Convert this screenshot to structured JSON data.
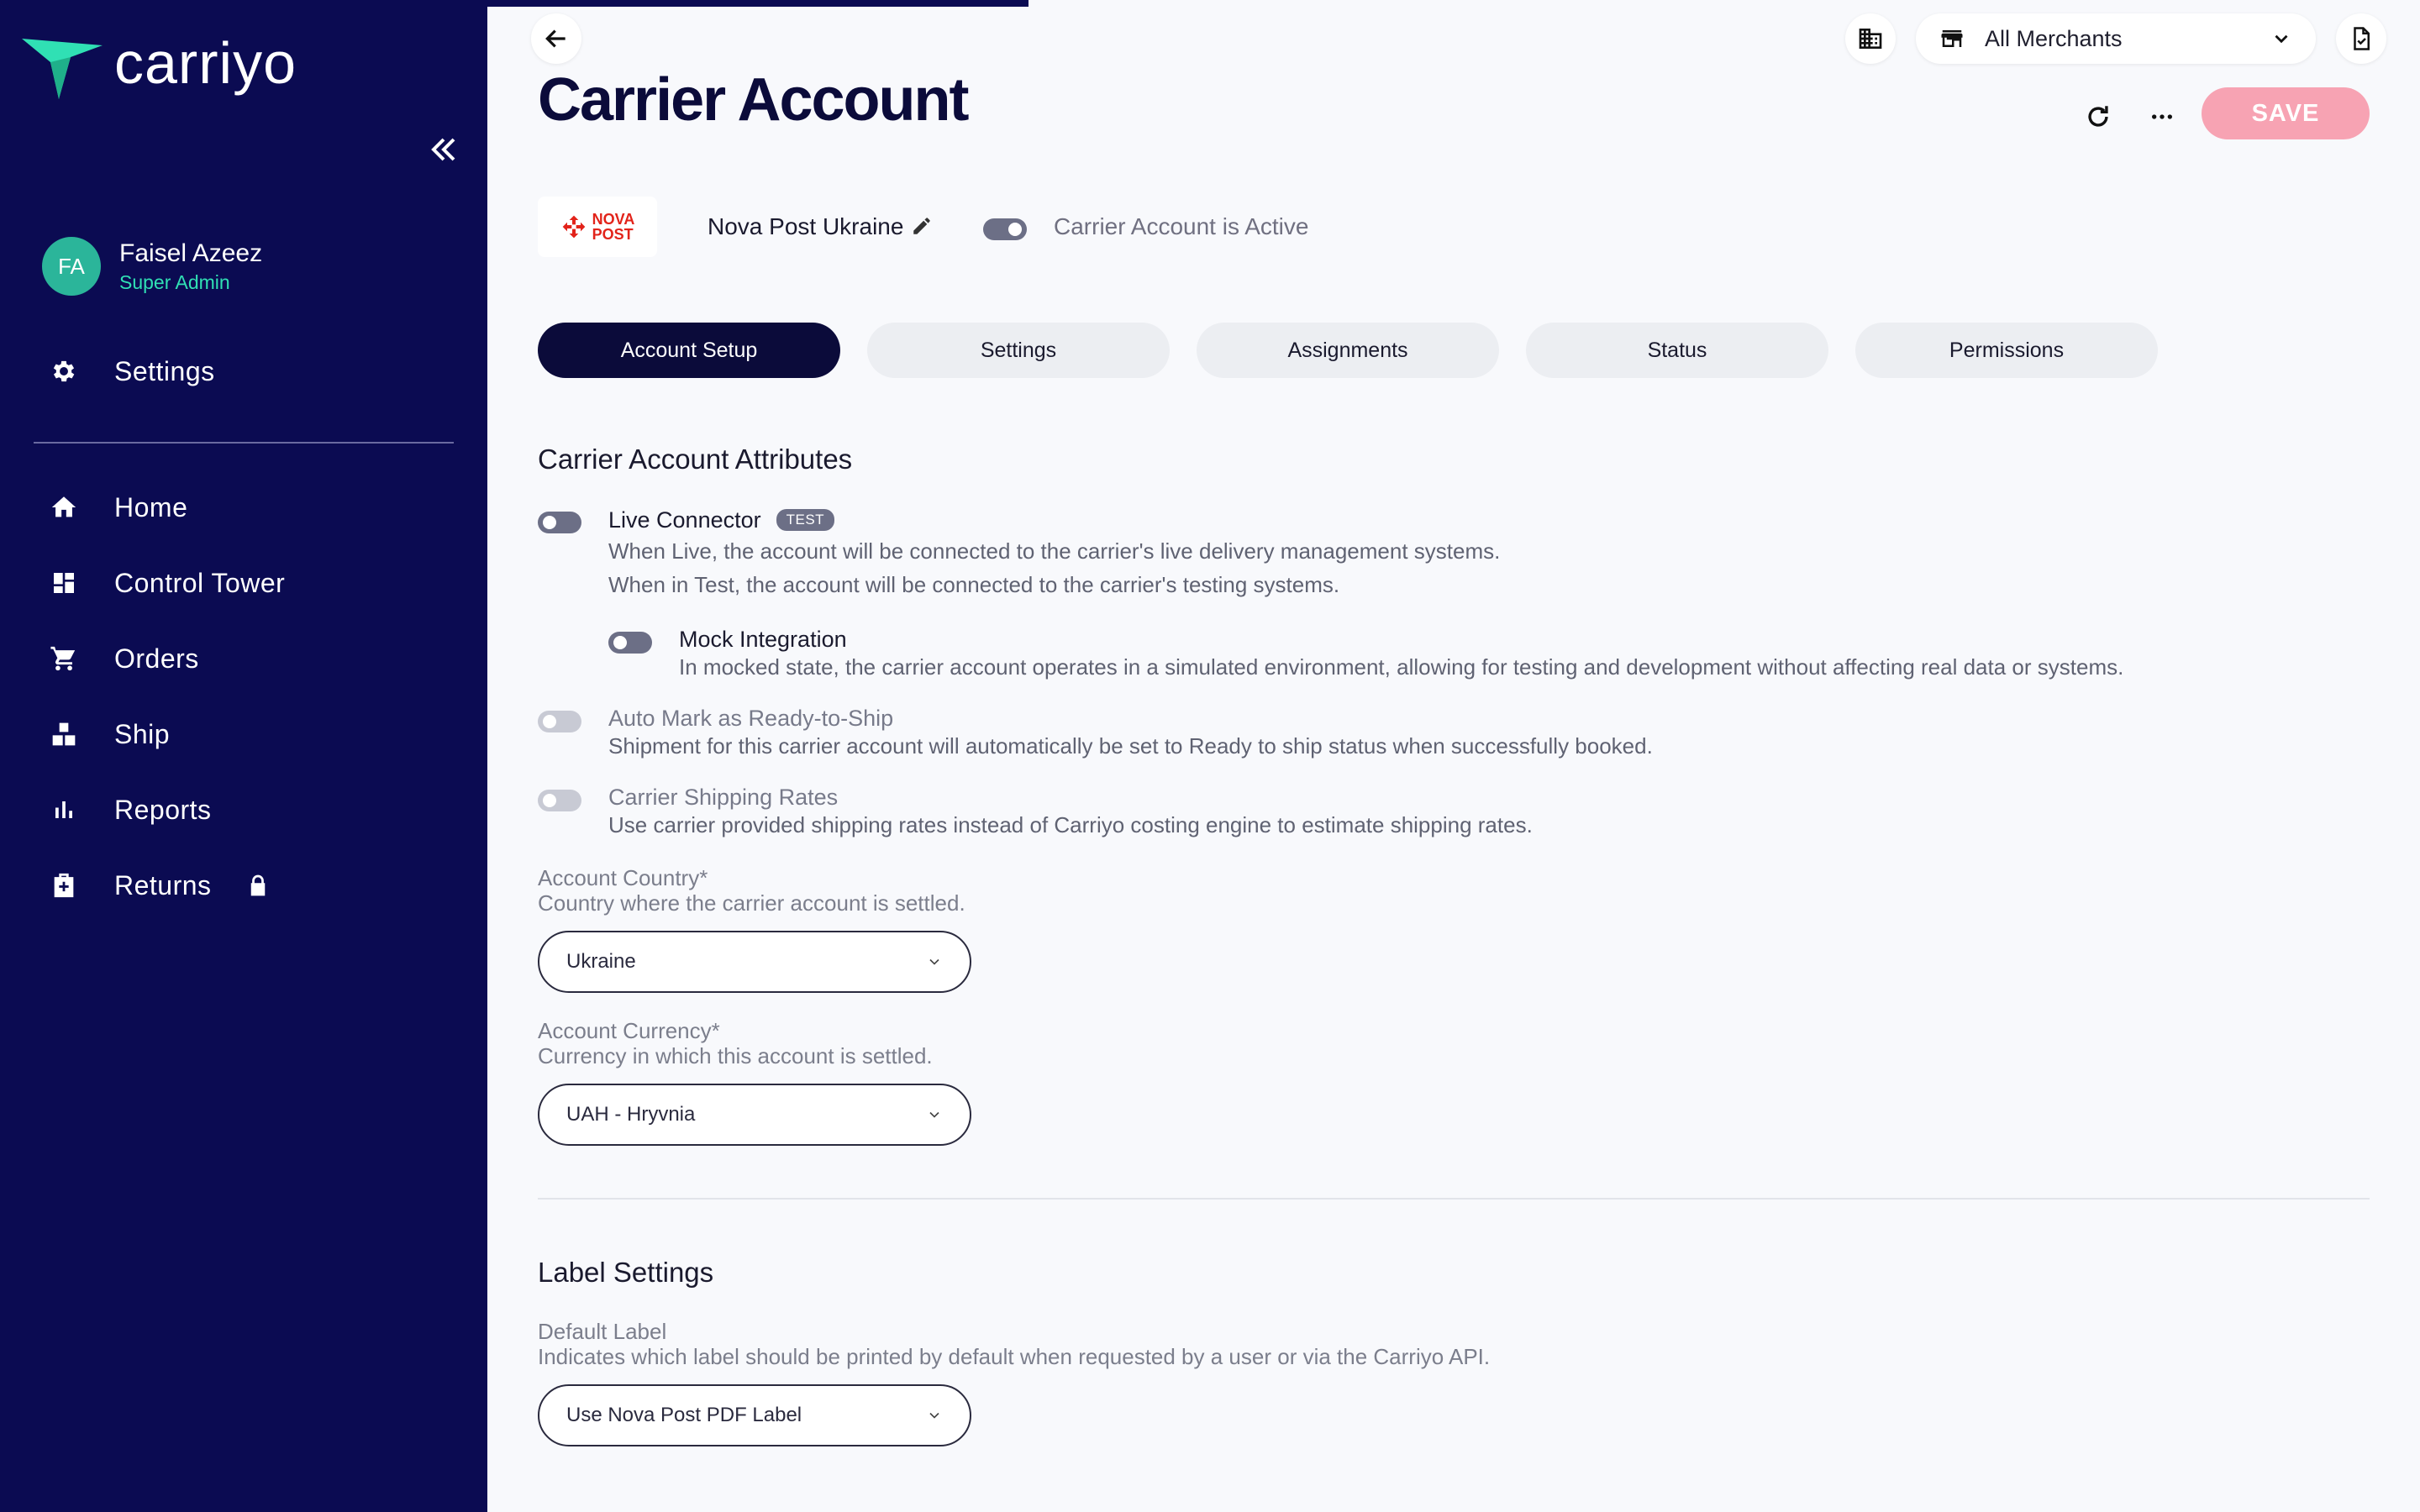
{
  "app": {
    "logo_text": "carriyo"
  },
  "user": {
    "initials": "FA",
    "name": "Faisel Azeez",
    "role": "Super Admin"
  },
  "sidebar": {
    "settings_label": "Settings",
    "items": [
      {
        "label": "Home",
        "icon": "home-icon"
      },
      {
        "label": "Control Tower",
        "icon": "dashboard-icon"
      },
      {
        "label": "Orders",
        "icon": "cart-icon"
      },
      {
        "label": "Ship",
        "icon": "ship-icon"
      },
      {
        "label": "Reports",
        "icon": "bar-chart-icon"
      },
      {
        "label": "Returns",
        "icon": "returns-icon",
        "locked": true
      }
    ]
  },
  "header": {
    "title": "Carrier Account",
    "merchant_selector": "All Merchants",
    "save_label": "SAVE"
  },
  "carrier": {
    "logo_line1": "NOVA",
    "logo_line2": "POST",
    "name": "Nova Post Ukraine",
    "status_label": "Carrier Account is Active"
  },
  "tabs": [
    {
      "label": "Account Setup",
      "active": true
    },
    {
      "label": "Settings",
      "active": false
    },
    {
      "label": "Assignments",
      "active": false
    },
    {
      "label": "Status",
      "active": false
    },
    {
      "label": "Permissions",
      "active": false
    }
  ],
  "attributes": {
    "title": "Carrier Account Attributes",
    "live_connector": {
      "title": "Live Connector",
      "badge": "TEST",
      "desc1": "When Live, the account will be connected to the carrier's live delivery management systems.",
      "desc2": "When in Test, the account will be connected to the carrier's testing systems."
    },
    "mock_integration": {
      "title": "Mock Integration",
      "desc": "In mocked state, the carrier account operates in a simulated environment, allowing for testing and development without affecting real data or systems."
    },
    "auto_mark": {
      "title": "Auto Mark as Ready-to-Ship",
      "desc": "Shipment for this carrier account will automatically be set to Ready to ship status when successfully booked."
    },
    "shipping_rates": {
      "title": "Carrier Shipping Rates",
      "desc": "Use carrier provided shipping rates instead of Carriyo costing engine to estimate shipping rates."
    },
    "account_country": {
      "label": "Account Country*",
      "desc": "Country where the carrier account is settled.",
      "value": "Ukraine"
    },
    "account_currency": {
      "label": "Account Currency*",
      "desc": "Currency in which this account is settled.",
      "value": "UAH - Hryvnia"
    }
  },
  "label_settings": {
    "title": "Label Settings",
    "default_label": {
      "label": "Default Label",
      "desc": "Indicates which label should be printed by default when requested by a user or via the Carriyo API.",
      "value": "Use Nova Post PDF Label"
    }
  },
  "colors": {
    "sidebar": "#0b0b52",
    "accent": "#30e0b4",
    "save": "#f7a3b3",
    "tab_active": "#0b0b3a"
  }
}
